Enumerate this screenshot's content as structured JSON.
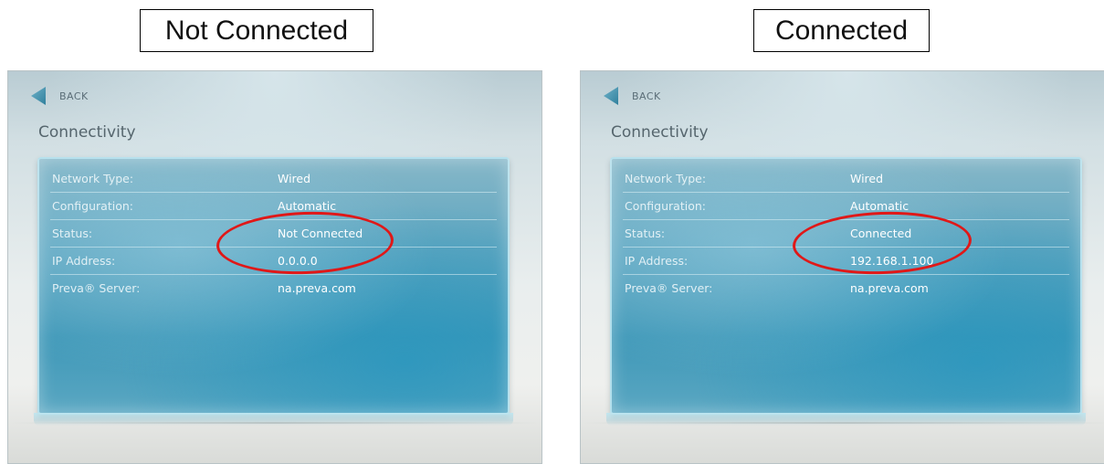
{
  "panels": [
    {
      "caption": "Not Connected",
      "back_label": "BACK",
      "title": "Connectivity",
      "rows": [
        {
          "label": "Network Type:",
          "value": "Wired"
        },
        {
          "label": "Configuration:",
          "value": "Automatic"
        },
        {
          "label": "Status:",
          "value": "Not Connected"
        },
        {
          "label": "IP Address:",
          "value": "0.0.0.0"
        },
        {
          "label": "Preva® Server:",
          "value": "na.preva.com"
        }
      ]
    },
    {
      "caption": "Connected",
      "back_label": "BACK",
      "title": "Connectivity",
      "rows": [
        {
          "label": "Network Type:",
          "value": "Wired"
        },
        {
          "label": "Configuration:",
          "value": "Automatic"
        },
        {
          "label": "Status:",
          "value": "Connected"
        },
        {
          "label": "IP Address:",
          "value": "192.168.1.100"
        },
        {
          "label": "Preva® Server:",
          "value": "na.preva.com"
        }
      ]
    }
  ],
  "colors": {
    "highlight_ellipse": "#e01818",
    "panel_blue": "#3f98b8"
  },
  "icons": {
    "back": "back-arrow-icon"
  }
}
